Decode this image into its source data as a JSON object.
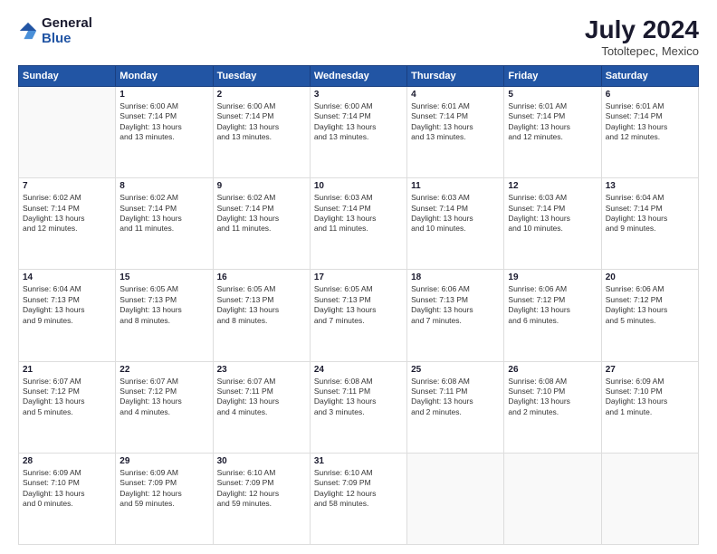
{
  "header": {
    "logo_general": "General",
    "logo_blue": "Blue",
    "month_year": "July 2024",
    "location": "Totoltepec, Mexico"
  },
  "weekdays": [
    "Sunday",
    "Monday",
    "Tuesday",
    "Wednesday",
    "Thursday",
    "Friday",
    "Saturday"
  ],
  "weeks": [
    [
      {
        "day": "",
        "info": ""
      },
      {
        "day": "1",
        "info": "Sunrise: 6:00 AM\nSunset: 7:14 PM\nDaylight: 13 hours\nand 13 minutes."
      },
      {
        "day": "2",
        "info": "Sunrise: 6:00 AM\nSunset: 7:14 PM\nDaylight: 13 hours\nand 13 minutes."
      },
      {
        "day": "3",
        "info": "Sunrise: 6:00 AM\nSunset: 7:14 PM\nDaylight: 13 hours\nand 13 minutes."
      },
      {
        "day": "4",
        "info": "Sunrise: 6:01 AM\nSunset: 7:14 PM\nDaylight: 13 hours\nand 13 minutes."
      },
      {
        "day": "5",
        "info": "Sunrise: 6:01 AM\nSunset: 7:14 PM\nDaylight: 13 hours\nand 12 minutes."
      },
      {
        "day": "6",
        "info": "Sunrise: 6:01 AM\nSunset: 7:14 PM\nDaylight: 13 hours\nand 12 minutes."
      }
    ],
    [
      {
        "day": "7",
        "info": "Sunrise: 6:02 AM\nSunset: 7:14 PM\nDaylight: 13 hours\nand 12 minutes."
      },
      {
        "day": "8",
        "info": "Sunrise: 6:02 AM\nSunset: 7:14 PM\nDaylight: 13 hours\nand 11 minutes."
      },
      {
        "day": "9",
        "info": "Sunrise: 6:02 AM\nSunset: 7:14 PM\nDaylight: 13 hours\nand 11 minutes."
      },
      {
        "day": "10",
        "info": "Sunrise: 6:03 AM\nSunset: 7:14 PM\nDaylight: 13 hours\nand 11 minutes."
      },
      {
        "day": "11",
        "info": "Sunrise: 6:03 AM\nSunset: 7:14 PM\nDaylight: 13 hours\nand 10 minutes."
      },
      {
        "day": "12",
        "info": "Sunrise: 6:03 AM\nSunset: 7:14 PM\nDaylight: 13 hours\nand 10 minutes."
      },
      {
        "day": "13",
        "info": "Sunrise: 6:04 AM\nSunset: 7:14 PM\nDaylight: 13 hours\nand 9 minutes."
      }
    ],
    [
      {
        "day": "14",
        "info": "Sunrise: 6:04 AM\nSunset: 7:13 PM\nDaylight: 13 hours\nand 9 minutes."
      },
      {
        "day": "15",
        "info": "Sunrise: 6:05 AM\nSunset: 7:13 PM\nDaylight: 13 hours\nand 8 minutes."
      },
      {
        "day": "16",
        "info": "Sunrise: 6:05 AM\nSunset: 7:13 PM\nDaylight: 13 hours\nand 8 minutes."
      },
      {
        "day": "17",
        "info": "Sunrise: 6:05 AM\nSunset: 7:13 PM\nDaylight: 13 hours\nand 7 minutes."
      },
      {
        "day": "18",
        "info": "Sunrise: 6:06 AM\nSunset: 7:13 PM\nDaylight: 13 hours\nand 7 minutes."
      },
      {
        "day": "19",
        "info": "Sunrise: 6:06 AM\nSunset: 7:12 PM\nDaylight: 13 hours\nand 6 minutes."
      },
      {
        "day": "20",
        "info": "Sunrise: 6:06 AM\nSunset: 7:12 PM\nDaylight: 13 hours\nand 5 minutes."
      }
    ],
    [
      {
        "day": "21",
        "info": "Sunrise: 6:07 AM\nSunset: 7:12 PM\nDaylight: 13 hours\nand 5 minutes."
      },
      {
        "day": "22",
        "info": "Sunrise: 6:07 AM\nSunset: 7:12 PM\nDaylight: 13 hours\nand 4 minutes."
      },
      {
        "day": "23",
        "info": "Sunrise: 6:07 AM\nSunset: 7:11 PM\nDaylight: 13 hours\nand 4 minutes."
      },
      {
        "day": "24",
        "info": "Sunrise: 6:08 AM\nSunset: 7:11 PM\nDaylight: 13 hours\nand 3 minutes."
      },
      {
        "day": "25",
        "info": "Sunrise: 6:08 AM\nSunset: 7:11 PM\nDaylight: 13 hours\nand 2 minutes."
      },
      {
        "day": "26",
        "info": "Sunrise: 6:08 AM\nSunset: 7:10 PM\nDaylight: 13 hours\nand 2 minutes."
      },
      {
        "day": "27",
        "info": "Sunrise: 6:09 AM\nSunset: 7:10 PM\nDaylight: 13 hours\nand 1 minute."
      }
    ],
    [
      {
        "day": "28",
        "info": "Sunrise: 6:09 AM\nSunset: 7:10 PM\nDaylight: 13 hours\nand 0 minutes."
      },
      {
        "day": "29",
        "info": "Sunrise: 6:09 AM\nSunset: 7:09 PM\nDaylight: 12 hours\nand 59 minutes."
      },
      {
        "day": "30",
        "info": "Sunrise: 6:10 AM\nSunset: 7:09 PM\nDaylight: 12 hours\nand 59 minutes."
      },
      {
        "day": "31",
        "info": "Sunrise: 6:10 AM\nSunset: 7:09 PM\nDaylight: 12 hours\nand 58 minutes."
      },
      {
        "day": "",
        "info": ""
      },
      {
        "day": "",
        "info": ""
      },
      {
        "day": "",
        "info": ""
      }
    ]
  ]
}
